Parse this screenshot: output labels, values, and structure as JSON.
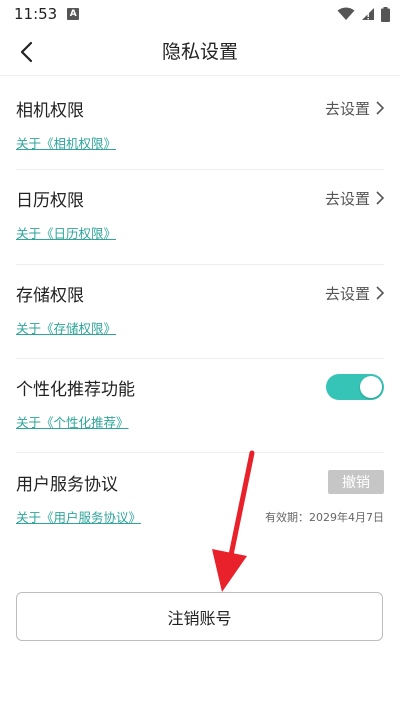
{
  "status_bar": {
    "time": "11:53",
    "a_badge": "A",
    "icons": [
      "wifi-icon",
      "signal-icon",
      "battery-icon"
    ]
  },
  "nav": {
    "title": "隐私设置",
    "back_icon": "chevron-left-icon"
  },
  "sections": {
    "camera": {
      "title": "相机权限",
      "action": "去设置",
      "link": "关于《相机权限》"
    },
    "calendar": {
      "title": "日历权限",
      "action": "去设置",
      "link": "关于《日历权限》"
    },
    "storage": {
      "title": "存储权限",
      "action": "去设置",
      "link": "关于《存储权限》"
    },
    "personalized": {
      "title": "个性化推荐功能",
      "toggle_on": true,
      "link": "关于《个性化推荐》"
    },
    "agreement": {
      "title": "用户服务协议",
      "action": "撤销",
      "link": "关于《用户服务协议》",
      "validity": "有效期：2029年4月7日"
    }
  },
  "cancel_account": {
    "label": "注销账号"
  },
  "colors": {
    "accent": "#35c4b5",
    "link": "#2ea59a",
    "revoke_bg": "#c6c6c6",
    "annotation_arrow": "#e8212a"
  }
}
